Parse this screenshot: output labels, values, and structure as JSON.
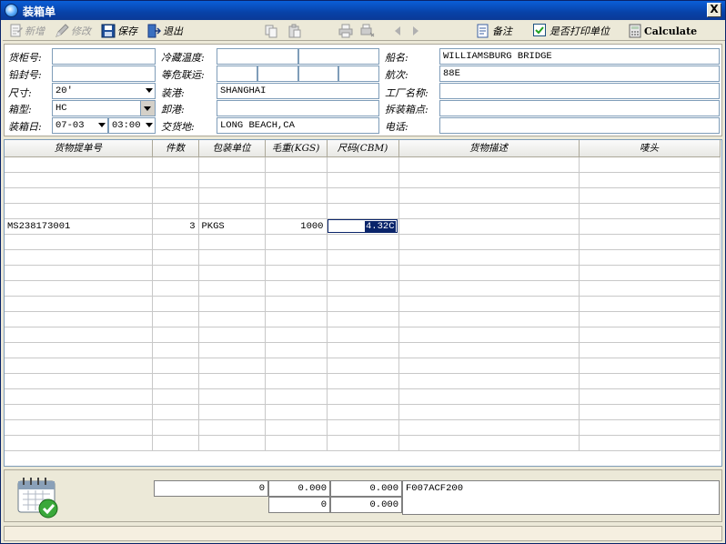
{
  "window": {
    "title": "装箱单",
    "close_label": "X"
  },
  "toolbar": {
    "new_label": "新增",
    "edit_label": "修改",
    "save_label": "保存",
    "exit_label": "退出",
    "remark_label": "备注",
    "print_unit_label": "是否打印单位",
    "print_unit_checked": true,
    "remark_checked": false,
    "calculate_label": "Calculate"
  },
  "form": {
    "container_no_label": "货柜号:",
    "container_no": "",
    "seal_no_label": "铅封号:",
    "seal_no": "",
    "size_label": "尺寸:",
    "size": "20'",
    "box_type_label": "箱型:",
    "box_type": "HC",
    "load_date_label": "装箱日:",
    "load_date": "07-03",
    "load_time": "03:00",
    "reefer_temp_label": "冷藏温度:",
    "reefer_temp": "",
    "dangerous_label": "等危联运:",
    "dangerous": "",
    "loading_port_label": "装港:",
    "loading_port": "SHANGHAI",
    "discharge_port_label": "卸港:",
    "discharge_port": "",
    "delivery_place_label": "交货地:",
    "delivery_place": "LONG BEACH,CA",
    "vessel_label": "船名:",
    "vessel": "WILLIAMSBURG BRIDGE",
    "voyage_label": "航次:",
    "voyage": "88E",
    "factory_label": "工厂名称:",
    "factory": "",
    "unpack_place_label": "拆装箱点:",
    "unpack_place": "",
    "phone_label": "电话:",
    "phone": ""
  },
  "grid": {
    "columns": [
      "货物提单号",
      "件数",
      "包装单位",
      "毛重(KGS)",
      "尺码(CBM)",
      "货物描述",
      "唛头"
    ],
    "rows": [
      [
        "",
        "",
        "",
        "",
        "",
        "",
        ""
      ],
      [
        "",
        "",
        "",
        "",
        "",
        "",
        ""
      ],
      [
        "",
        "",
        "",
        "",
        "",
        "",
        ""
      ],
      [
        "",
        "",
        "",
        "",
        "",
        "",
        ""
      ],
      [
        "MS238173001",
        "3",
        "PKGS",
        "1000",
        "4.32C",
        "",
        ""
      ]
    ]
  },
  "footer": {
    "total_pieces": "0",
    "total_weight": "0.000",
    "total_volume": "0.000",
    "code": "F007ACF200",
    "row2_a": "0",
    "row2_b": "0.000"
  }
}
